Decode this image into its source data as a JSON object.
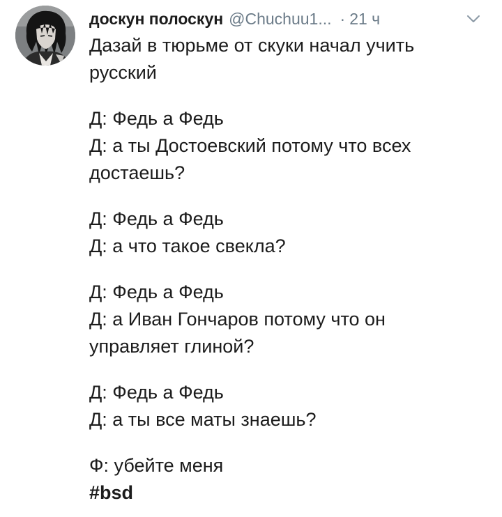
{
  "tweet": {
    "author": {
      "display_name": "доскун полоскун",
      "handle": "@Chuchuu1...",
      "avatar_icon": "anime-character-avatar"
    },
    "separator": "·",
    "time": "21 ч",
    "menu_icon": "chevron-down-icon",
    "lines": [
      "Дазай в тюрьме от скуки начал учить",
      "русский"
    ],
    "exchanges": [
      {
        "lines": [
          "Д: Федь а Федь",
          "Д: а ты Достоевский потому что всех",
          "достаешь?"
        ]
      },
      {
        "lines": [
          "Д: Федь а Федь",
          "Д: а что такое свекла?"
        ]
      },
      {
        "lines": [
          "Д: Федь а Федь",
          "Д: а Иван Гончаров потому что он",
          "управляет глиной?"
        ]
      },
      {
        "lines": [
          "Д: Федь а Федь",
          "Д: а ты все маты знаешь?"
        ]
      },
      {
        "lines": [
          "Ф: убейте меня"
        ]
      }
    ],
    "hashtag": "#bsd"
  },
  "colors": {
    "text": "#1c1c1c",
    "muted": "#6b7b88",
    "background": "#ffffff"
  }
}
